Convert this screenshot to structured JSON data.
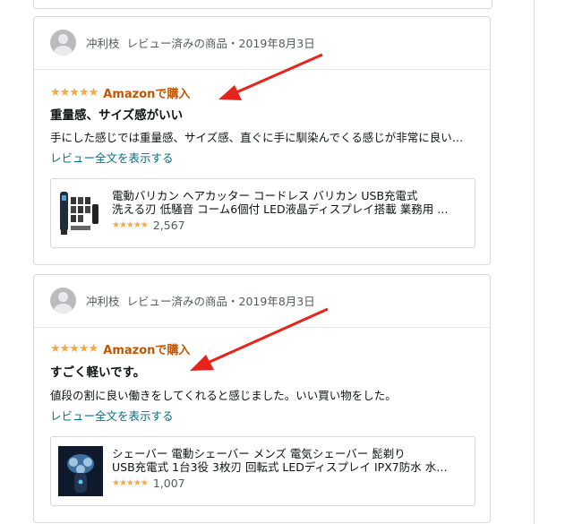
{
  "accent": {
    "star": "#f3a847",
    "verified": "#c45500",
    "link": "#007185",
    "arrow": "#e8231b"
  },
  "reviews": [
    {
      "reviewer": "冲利枝",
      "meta": "レビュー済みの商品・2019年8月3日",
      "stars": "★★★★★",
      "badge": "Amazonで購入",
      "title": "重量感、サイズ感がいい",
      "body": "手にした感じでは重量感、サイズ感、直ぐに手に馴染んでくる感じが非常に良い…",
      "read_more": "レビュー全文を表示する",
      "product": {
        "title_line1": "電動バリカン ヘアカッター コードレス バリカン USB充電式",
        "title_line2": "洗える刃 低騒音 コーム6個付 LED液晶ディスプレイ搭載 業務用 …",
        "stars": "★★★★★",
        "count": "2,567",
        "image_icon": "hair-clipper-product-image"
      }
    },
    {
      "reviewer": "冲利枝",
      "meta": "レビュー済みの商品・2019年8月3日",
      "stars": "★★★★★",
      "badge": "Amazonで購入",
      "title": "すごく軽いです。",
      "body": "値段の割に良い働きをしてくれると感じました。いい買い物をした。",
      "read_more": "レビュー全文を表示する",
      "product": {
        "title_line1": "シェーバー 電動シェーバー メンズ 電気シェーバー 髭剃り",
        "title_line2": "USB充電式 1台3役 3枚刃 回転式 LEDディスプレイ IPX7防水 水…",
        "stars": "★★★★★",
        "count": "1,007",
        "image_icon": "electric-shaver-product-image"
      }
    }
  ]
}
